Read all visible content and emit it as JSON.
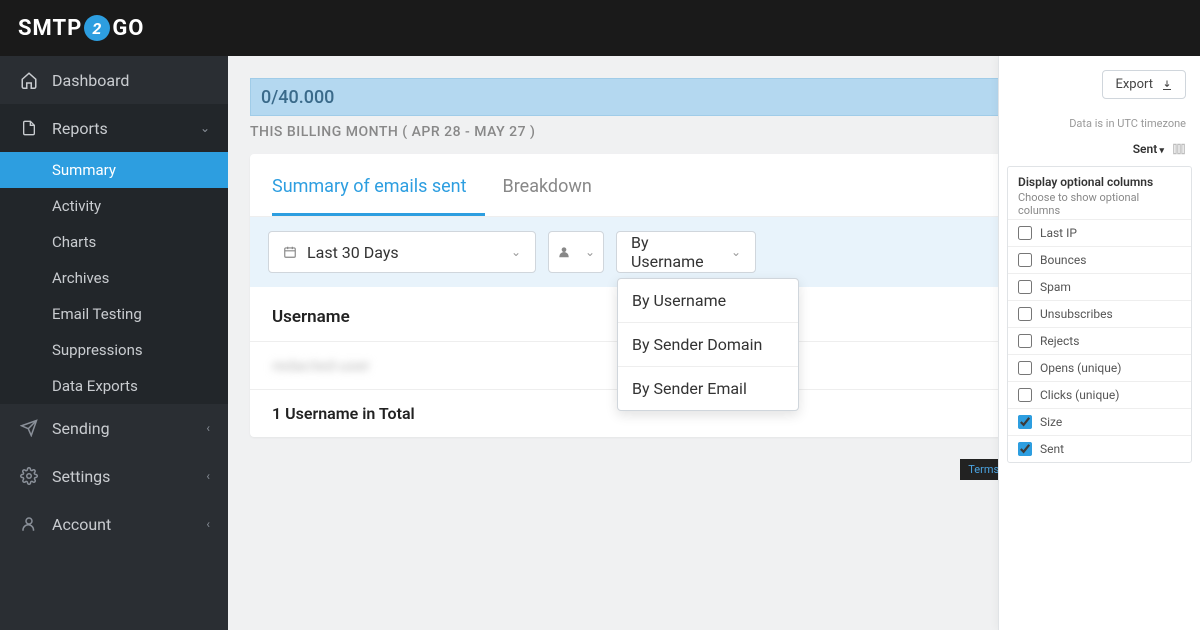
{
  "logo": {
    "pre": "SMTP",
    "two": "2",
    "post": "GO"
  },
  "sidebar": {
    "items": [
      {
        "label": "Dashboard",
        "icon": "home"
      },
      {
        "label": "Reports",
        "icon": "file",
        "expanded": true,
        "chev": "down",
        "sub": [
          {
            "label": "Summary",
            "active": true
          },
          {
            "label": "Activity"
          },
          {
            "label": "Charts"
          },
          {
            "label": "Archives"
          },
          {
            "label": "Email Testing"
          },
          {
            "label": "Suppressions"
          },
          {
            "label": "Data Exports"
          }
        ]
      },
      {
        "label": "Sending",
        "icon": "send",
        "chev": "right"
      },
      {
        "label": "Settings",
        "icon": "gear",
        "chev": "right"
      },
      {
        "label": "Account",
        "icon": "user",
        "chev": "right"
      }
    ]
  },
  "quota": "0/40.000",
  "billing_label": "THIS BILLING MONTH ( APR 28 - MAY 27 )",
  "tabs": [
    {
      "label": "Summary of emails sent",
      "active": true
    },
    {
      "label": "Breakdown"
    }
  ],
  "filters": {
    "date": "Last 30 Days",
    "group": "By Username",
    "group_options": [
      "By Username",
      "By Sender Domain",
      "By Sender Email"
    ]
  },
  "table": {
    "header": "Username",
    "row_placeholder": "redacted-user",
    "footer": "1 Username in Total"
  },
  "right": {
    "export": "Export",
    "tz": "Data is in UTC timezone",
    "sort": "Sent",
    "opt_title": "Display optional columns",
    "opt_sub": "Choose to show optional columns",
    "columns": [
      {
        "label": "Last IP",
        "checked": false
      },
      {
        "label": "Bounces",
        "checked": false
      },
      {
        "label": "Spam",
        "checked": false
      },
      {
        "label": "Unsubscribes",
        "checked": false
      },
      {
        "label": "Rejects",
        "checked": false
      },
      {
        "label": "Opens (unique)",
        "checked": false
      },
      {
        "label": "Clicks (unique)",
        "checked": false
      },
      {
        "label": "Size",
        "checked": true
      },
      {
        "label": "Sent",
        "checked": true
      }
    ]
  },
  "terms": "Terms of"
}
